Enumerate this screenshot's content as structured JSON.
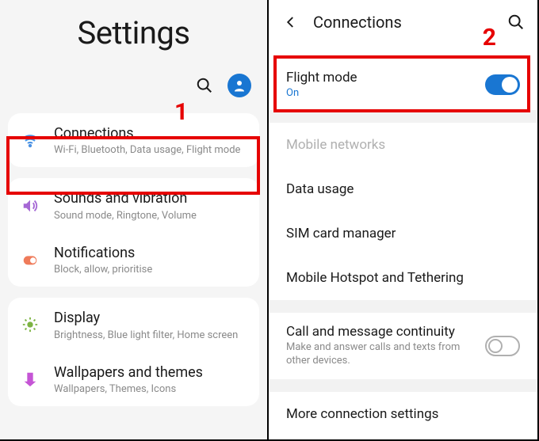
{
  "left": {
    "title": "Settings",
    "step_label": "1",
    "items": [
      {
        "title": "Connections",
        "subtitle": "Wi-Fi, Bluetooth, Data usage, Flight mode",
        "icon": "wifi-icon",
        "icon_color": "#4a90e2"
      },
      {
        "title": "Sounds and vibration",
        "subtitle": "Sound mode, Ringtone, Volume",
        "icon": "sound-icon",
        "icon_color": "#a668d5"
      },
      {
        "title": "Notifications",
        "subtitle": "Block, allow, prioritise",
        "icon": "notifications-icon",
        "icon_color": "#ef7b5a"
      },
      {
        "title": "Display",
        "subtitle": "Brightness, Blue light filter, Home screen",
        "icon": "display-icon",
        "icon_color": "#7cb342"
      },
      {
        "title": "Wallpapers and themes",
        "subtitle": "Wallpapers, Themes, Icons",
        "icon": "wallpapers-icon",
        "icon_color": "#c555d5"
      }
    ]
  },
  "right": {
    "title": "Connections",
    "step_label": "2",
    "rows": {
      "flight_mode": {
        "title": "Flight mode",
        "status": "On",
        "toggle_on": true
      },
      "mobile_networks": {
        "title": "Mobile networks"
      },
      "data_usage": {
        "title": "Data usage"
      },
      "sim_manager": {
        "title": "SIM card manager"
      },
      "hotspot": {
        "title": "Mobile Hotspot and Tethering"
      },
      "call_continuity": {
        "title": "Call and message continuity",
        "subtitle": "Make and answer calls and texts from other devices.",
        "toggle_on": false
      },
      "more": {
        "title": "More connection settings"
      }
    }
  }
}
